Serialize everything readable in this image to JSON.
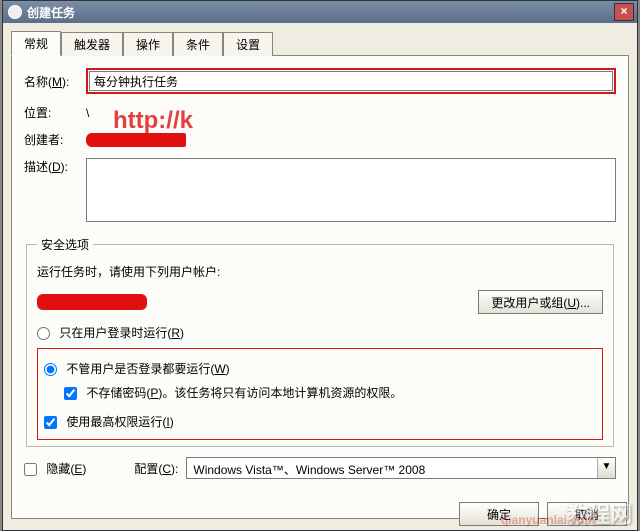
{
  "window": {
    "title": "创建任务",
    "close_glyph": "×"
  },
  "tabs": [
    "常规",
    "触发器",
    "操作",
    "条件",
    "设置"
  ],
  "general": {
    "name_label": "名称(",
    "name_hotkey": "M",
    "name_label_end": "):",
    "name_value": "每分钟执行任务",
    "location_label": "位置:",
    "location_value": "\\",
    "author_label": "创建者:",
    "description_label": "描述(",
    "description_hotkey": "D",
    "description_label_end": "):",
    "description_value": ""
  },
  "security": {
    "legend": "安全选项",
    "runas_label": "运行任务时，请使用下列用户帐户:",
    "change_user_btn": "更改用户或组(",
    "change_user_hotkey": "U",
    "change_user_btn_end": ")...",
    "radio_logged": "只在用户登录时运行(",
    "radio_logged_hotkey": "R",
    "radio_logged_end": ")",
    "radio_always": "不管用户是否登录都要运行(",
    "radio_always_hotkey": "W",
    "radio_always_end": ")",
    "nostore": "不存储密码(",
    "nostore_hotkey": "P",
    "nostore_end": ")。该任务将只有访问本地计算机资源的权限。",
    "highest": "使用最高权限运行(",
    "highest_hotkey": "I",
    "highest_end": ")"
  },
  "bottom": {
    "hidden_label": "隐藏(",
    "hidden_hotkey": "E",
    "hidden_label_end": ")",
    "config_label": "配置(",
    "config_hotkey": "C",
    "config_label_end": "):",
    "config_value": "Windows Vista™、Windows Server™ 2008"
  },
  "dialog": {
    "ok": "确定",
    "cancel": "取消"
  },
  "overlay": {
    "url": "http://k",
    "br": "教程网",
    "br2": "qianyuanlai.com"
  }
}
